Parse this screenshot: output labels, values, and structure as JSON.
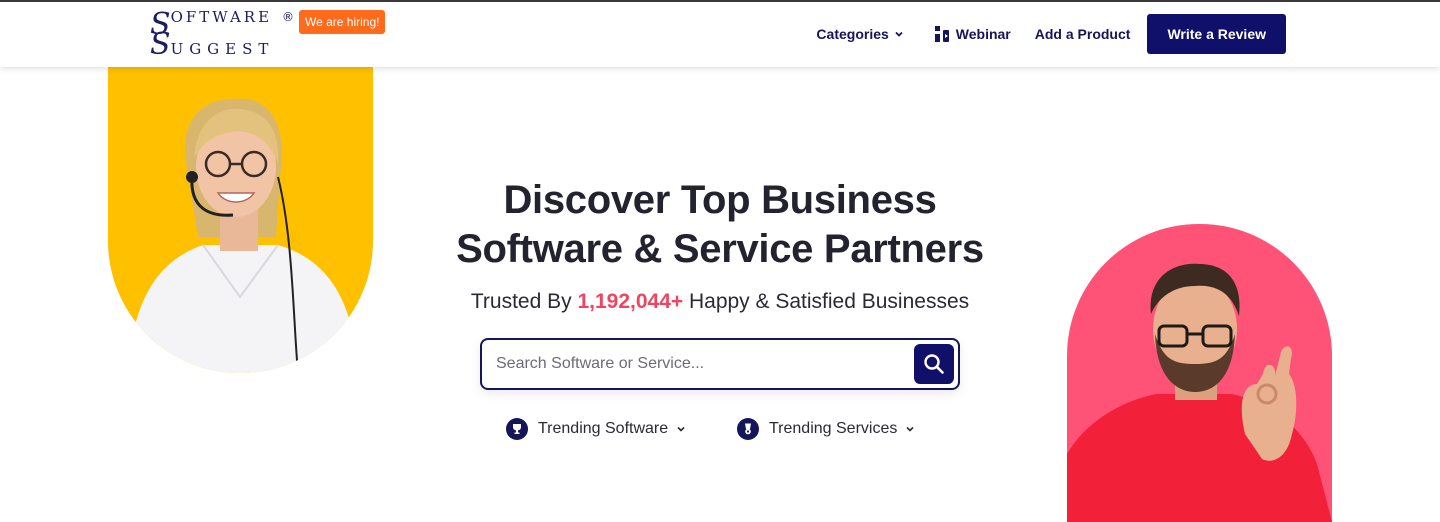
{
  "header": {
    "logo": {
      "line1_cap": "S",
      "line1_rest": "OFTWARE",
      "registered": "®",
      "line2_cap": "S",
      "line2_rest": "UGGEST"
    },
    "hiring_badge": "We are hiring!",
    "nav": {
      "categories": "Categories",
      "webinar": "Webinar",
      "add_product": "Add a Product",
      "write_review": "Write a Review"
    }
  },
  "hero": {
    "title_line1": "Discover Top Business",
    "title_line2": "Software & Service Partners",
    "subtitle_prefix": "Trusted By ",
    "subtitle_count": "1,192,044+",
    "subtitle_suffix": " Happy & Satisfied Businesses",
    "search": {
      "placeholder": "Search Software or Service...",
      "value": ""
    },
    "trending_software": "Trending Software",
    "trending_services": "Trending Services"
  },
  "colors": {
    "brand_navy": "#10106a",
    "accent_orange": "#ff6b1a",
    "accent_pink": "#f0455f",
    "left_portrait_bg": "#ffc000",
    "right_portrait_bg": "#ff5277"
  },
  "icons": [
    "chevron-down-icon",
    "webinar-icon",
    "search-icon",
    "trophy-icon",
    "award-icon"
  ]
}
